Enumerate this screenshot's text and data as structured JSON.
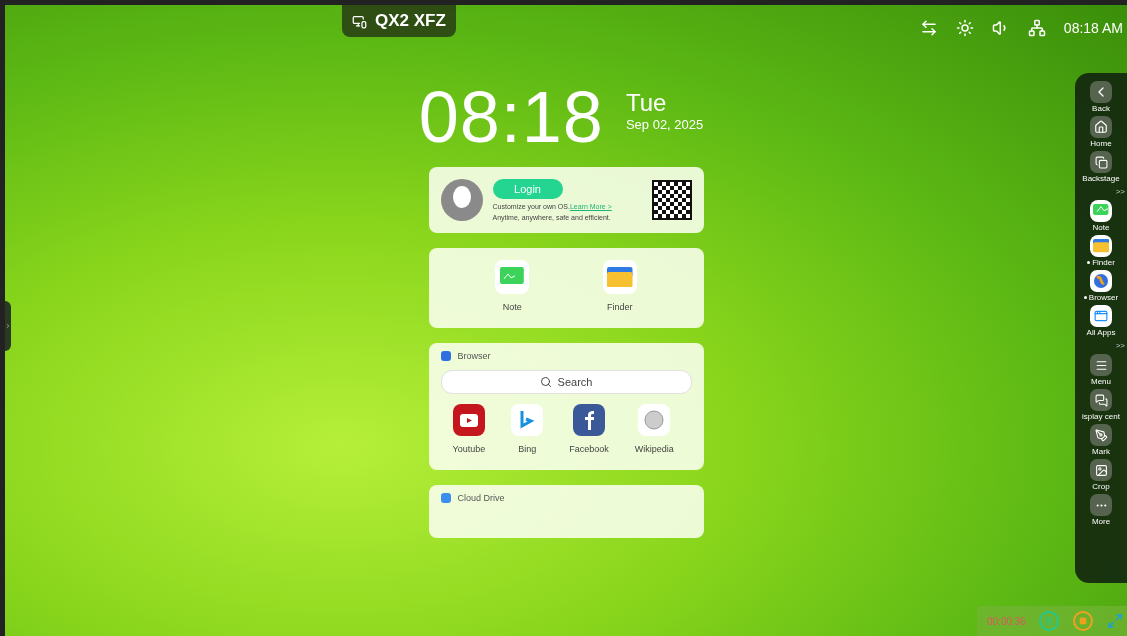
{
  "device_badge": {
    "label": "QX2 XFZ"
  },
  "status_bar": {
    "time": "08:18 AM"
  },
  "clock": {
    "time": "08:18",
    "weekday": "Tue",
    "date": "Sep 02, 2025"
  },
  "login_card": {
    "button": "Login",
    "line1": "Customize your own OS.",
    "link": "Learn More >",
    "line2": "Anytime, anywhere, safe and efficient."
  },
  "apps_card": {
    "apps": [
      {
        "kind": "note",
        "label": "Note"
      },
      {
        "kind": "finder",
        "label": "Finder"
      }
    ]
  },
  "browser_card": {
    "title": "Browser",
    "search_placeholder": "Search",
    "sites": [
      {
        "kind": "youtube",
        "label": "Youtube"
      },
      {
        "kind": "bing",
        "label": "Bing"
      },
      {
        "kind": "facebook",
        "label": "Facebook"
      },
      {
        "kind": "wikipedia",
        "label": "Wikipedia"
      }
    ]
  },
  "cloud_card": {
    "title": "Cloud Drive"
  },
  "sidebar": {
    "items": [
      {
        "kind": "back",
        "label": "Back",
        "running": false
      },
      {
        "kind": "home",
        "label": "Home",
        "running": false
      },
      {
        "kind": "backstage",
        "label": "Backstage",
        "running": false
      },
      {
        "kind": "separator",
        "label": ">>"
      },
      {
        "kind": "note",
        "label": "Note",
        "running": false
      },
      {
        "kind": "finder",
        "label": "Finder",
        "running": true
      },
      {
        "kind": "browser",
        "label": "Browser",
        "running": true
      },
      {
        "kind": "apps",
        "label": "All Apps",
        "running": false
      },
      {
        "kind": "separator",
        "label": ">>"
      },
      {
        "kind": "menu",
        "label": "Menu",
        "running": false
      },
      {
        "kind": "display",
        "label": "isplay cent",
        "running": false
      },
      {
        "kind": "mark",
        "label": "Mark",
        "running": false
      },
      {
        "kind": "crop",
        "label": "Crop",
        "running": false
      },
      {
        "kind": "more",
        "label": "More",
        "running": false
      }
    ]
  },
  "recorder": {
    "elapsed": "00:00:36"
  }
}
